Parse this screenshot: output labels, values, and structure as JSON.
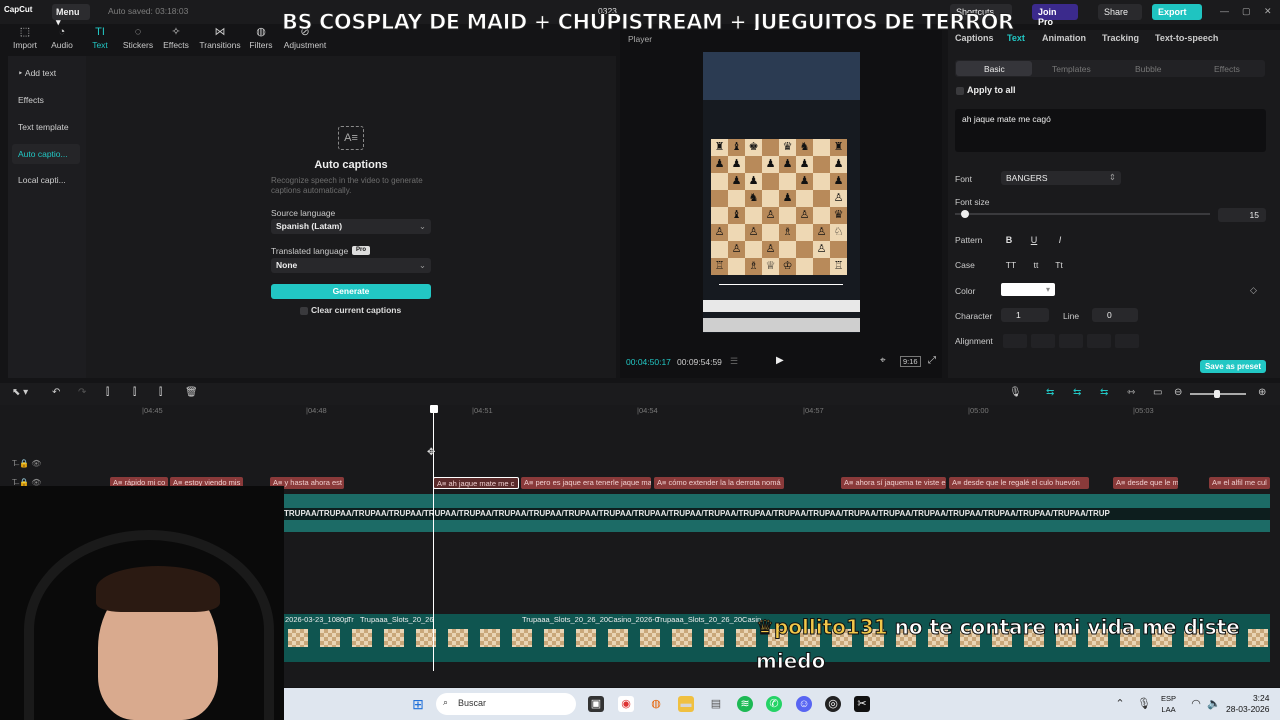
{
  "app": {
    "logo": "CapCut",
    "menu_label": "Menu",
    "autosave": "Auto saved: 03:18:03",
    "project_name": "0323",
    "shortcuts": "Shortcuts",
    "join_pro": "Join Pro",
    "share": "Share",
    "export": "Export"
  },
  "stream_title": "BS COSPLAY DE MAID + CHUPISTREAM + JUEGUITOS DE TERROR",
  "toolbar": {
    "tabs": [
      {
        "label": "Import",
        "icon": "import-icon"
      },
      {
        "label": "Audio",
        "icon": "audio-icon"
      },
      {
        "label": "Text",
        "icon": "text-icon",
        "active": true
      },
      {
        "label": "Stickers",
        "icon": "stickers-icon"
      },
      {
        "label": "Effects",
        "icon": "effects-icon"
      },
      {
        "label": "Transitions",
        "icon": "transitions-icon"
      },
      {
        "label": "Filters",
        "icon": "filters-icon"
      },
      {
        "label": "Adjustment",
        "icon": "adjustment-icon"
      }
    ]
  },
  "sidebar": {
    "items": [
      {
        "label": "Add text"
      },
      {
        "label": "Effects"
      },
      {
        "label": "Text template"
      },
      {
        "label": "Auto captio...",
        "active": true
      },
      {
        "label": "Local capti..."
      }
    ]
  },
  "auto_captions": {
    "title": "Auto captions",
    "description": "Recognize speech in the video to generate captions automatically.",
    "source_label": "Source language",
    "source_value": "Spanish (Latam)",
    "translated_label": "Translated language",
    "translated_badge": "Pro",
    "translated_value": "None",
    "generate": "Generate",
    "clear_label": "Clear current captions"
  },
  "player": {
    "label": "Player",
    "current_time": "00:04:50:17",
    "total_time": "00:09:54:59",
    "ratio": "9:16"
  },
  "properties": {
    "tabs": [
      "Captions",
      "Text",
      "Animation",
      "Tracking",
      "Text-to-speech"
    ],
    "active_tab": "Text",
    "subtabs": [
      "Basic",
      "Templates",
      "Bubble",
      "Effects"
    ],
    "apply_all": "Apply to all",
    "text_value": "ah jaque mate me cagó",
    "font_label": "Font",
    "font_value": "BANGERS",
    "font_size_label": "Font size",
    "font_size_value": "15",
    "font_size_fraction": 0.03,
    "pattern_label": "Pattern",
    "pattern_buttons": [
      "B",
      "U",
      "I"
    ],
    "case_label": "Case",
    "case_buttons": [
      "TT",
      "tt",
      "Tt"
    ],
    "color_label": "Color",
    "color_value": "#ffffff",
    "character_label": "Character",
    "character_value": "1",
    "line_label": "Line",
    "line_value": "0",
    "alignment_label": "Alignment",
    "save_preset": "Save as preset"
  },
  "timeline": {
    "ticks": [
      "|04:45",
      "|04:48",
      "|04:51",
      "|04:54",
      "|04:57",
      "|05:00",
      "|05:03"
    ],
    "captions": [
      "rápido mi co",
      "estoy viendo mis",
      "y hasta ahora est",
      "ah jaque mate me c",
      "pero es jaque era tenerle jaque ma",
      "cómo extender la la derrota nomá",
      "ahora sí jaquema te viste e",
      "desde que le regalé el culo huevón",
      "desde que le m",
      "el alfil me cul"
    ],
    "overlay_text": "TRUPAA/TRUPAA/TRUPAA/TRUPAA/TRUPAA/TRUPAA/TRUPAA/TRUPAA/TRUPAA/TRUPAA/TRUPAA/TRUPAA/TRUPAA/TRUPAA/TRUPAA/TRUPAA/TRUPAA/TRUPAA/TRUPAA/TRUPAA/TRUPAA/TRUPAA/TRUPAA/TRUP",
    "video_clips": [
      "2026-03-23_1080p",
      "Tr",
      "Trupaaa_Slots_20_26",
      "Trupaaa_Slots_20_26_20Casino_2026-0",
      "Trupaaa_Slots_20_26_20Casin"
    ]
  },
  "chat": {
    "user": "pollito131",
    "message": "no te contare mi vida me diste miedo"
  },
  "taskbar": {
    "search_placeholder": "Buscar",
    "lang_top": "ESP",
    "lang_bottom": "LAA",
    "time": "3:24",
    "date": "28-03-2026"
  }
}
